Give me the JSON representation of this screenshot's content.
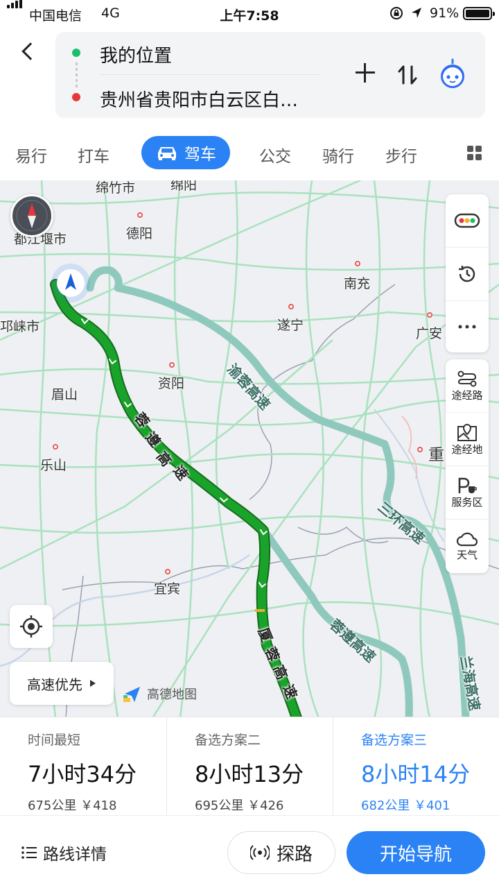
{
  "status_bar": {
    "carrier": "中国电信",
    "network": "4G",
    "time": "上午7:58",
    "battery": "91%"
  },
  "header": {
    "from": "我的位置",
    "to": "贵州省贵阳市白云区白…"
  },
  "tabs": [
    "易行",
    "打车",
    "驾车",
    "公交",
    "骑行",
    "步行"
  ],
  "active_tab": "驾车",
  "map": {
    "cities": [
      "绵竹市",
      "绵阳",
      "德阳",
      "都江堰市",
      "南充",
      "邛崃市",
      "遂宁",
      "广安",
      "眉山",
      "资阳",
      "乐山",
      "重",
      "宜宾"
    ],
    "roads": {
      "r1": "渝蓉高速",
      "r2a": "蓉",
      "r2b": "遵",
      "r2c": "高",
      "r2d": "速",
      "r3": "三环高速",
      "r4a": "厦",
      "r4b": "蓉",
      "r4c": "高",
      "r4d": "速",
      "r5": "蓉遵高速",
      "r6": "兰海高速"
    },
    "side_tools": [
      "途经路",
      "途经地",
      "服务区",
      "天气"
    ],
    "preference": "高速优先",
    "brand": "高德地图"
  },
  "routes": [
    {
      "tag": "时间最短",
      "duration": "7小时34分",
      "meta": "675公里 ￥418",
      "selected": false
    },
    {
      "tag": "备选方案二",
      "duration": "8小时13分",
      "meta": "695公里 ￥426",
      "selected": false
    },
    {
      "tag": "备选方案三",
      "duration": "8小时14分",
      "meta": "682公里 ￥401",
      "selected": true
    }
  ],
  "bottom": {
    "details": "路线详情",
    "explore": "探路",
    "start": "开始导航"
  },
  "colors": {
    "accent": "#2a82f5",
    "route_main": "#1aa32a",
    "route_alt": "#8fc9bd",
    "highway": "#9ddcb2"
  }
}
